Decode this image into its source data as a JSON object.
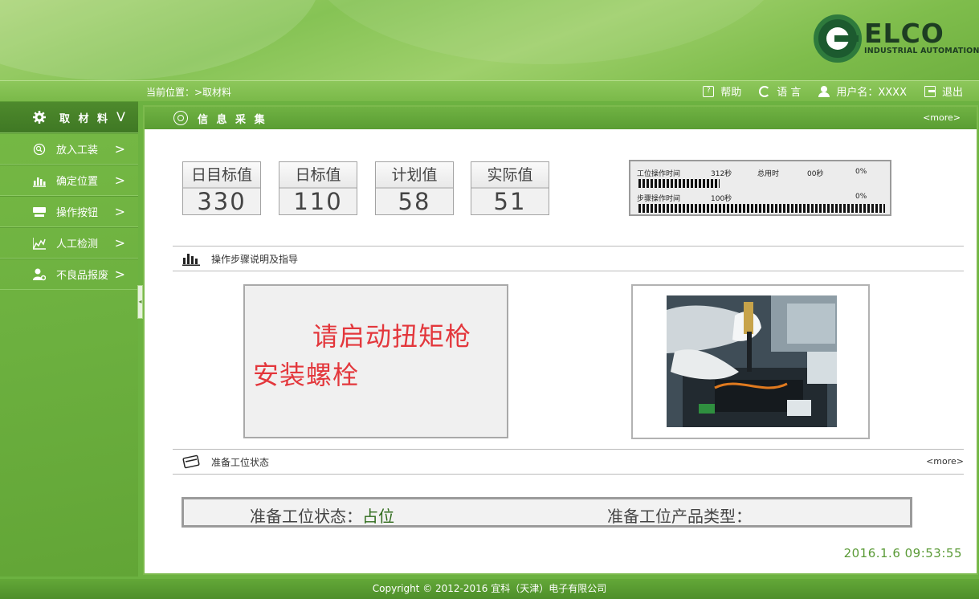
{
  "brand": {
    "name": "ELCO",
    "subtitle": "INDUSTRIAL AUTOMATION"
  },
  "breadcrumb": "当前位置：>取材料",
  "topnav": {
    "help": "帮助",
    "language": "语 言",
    "username": "用户名：XXXX",
    "logout": "退出"
  },
  "sidebar": {
    "items": [
      {
        "label": "取 材 料",
        "icon": "gear-icon",
        "arrow": "V"
      },
      {
        "label": "放入工装",
        "icon": "search-icon",
        "arrow": ">"
      },
      {
        "label": "确定位置",
        "icon": "bar-chart-icon",
        "arrow": ">"
      },
      {
        "label": "操作按钮",
        "icon": "monitor-icon",
        "arrow": ">"
      },
      {
        "label": "人工检测",
        "icon": "area-chart-icon",
        "arrow": ">"
      },
      {
        "label": "不良品报废",
        "icon": "user-gear-icon",
        "arrow": ">"
      }
    ]
  },
  "panel": {
    "title": "信 息 采 集",
    "more": "<more>"
  },
  "metrics": [
    {
      "label": "日目标值",
      "value": "330"
    },
    {
      "label": "日标值",
      "value": "110"
    },
    {
      "label": "计划值",
      "value": "58"
    },
    {
      "label": "实际值",
      "value": "51"
    }
  ],
  "timers": {
    "row1": {
      "label": "工位操作时间",
      "value": "312秒",
      "total_label": "总用时",
      "total_value": "00秒",
      "percent": "0%"
    },
    "row2": {
      "label": "步骤操作时间",
      "value": "100秒",
      "percent": "0%"
    },
    "progress1": 0.33,
    "progress2": 1.0
  },
  "steps": {
    "title": "操作步骤说明及指导"
  },
  "instruction": {
    "line1": "请启动扭矩枪",
    "line2": "安装螺栓"
  },
  "station": {
    "title": "准备工位状态",
    "more": "<more>",
    "status_label": "准备工位状态：",
    "status_value": "占位",
    "product_label": "准备工位产品类型："
  },
  "datetime": "2016.1.6  09:53:55",
  "footer": "Copyright © 2012-2016 宜科（天津）电子有限公司"
}
